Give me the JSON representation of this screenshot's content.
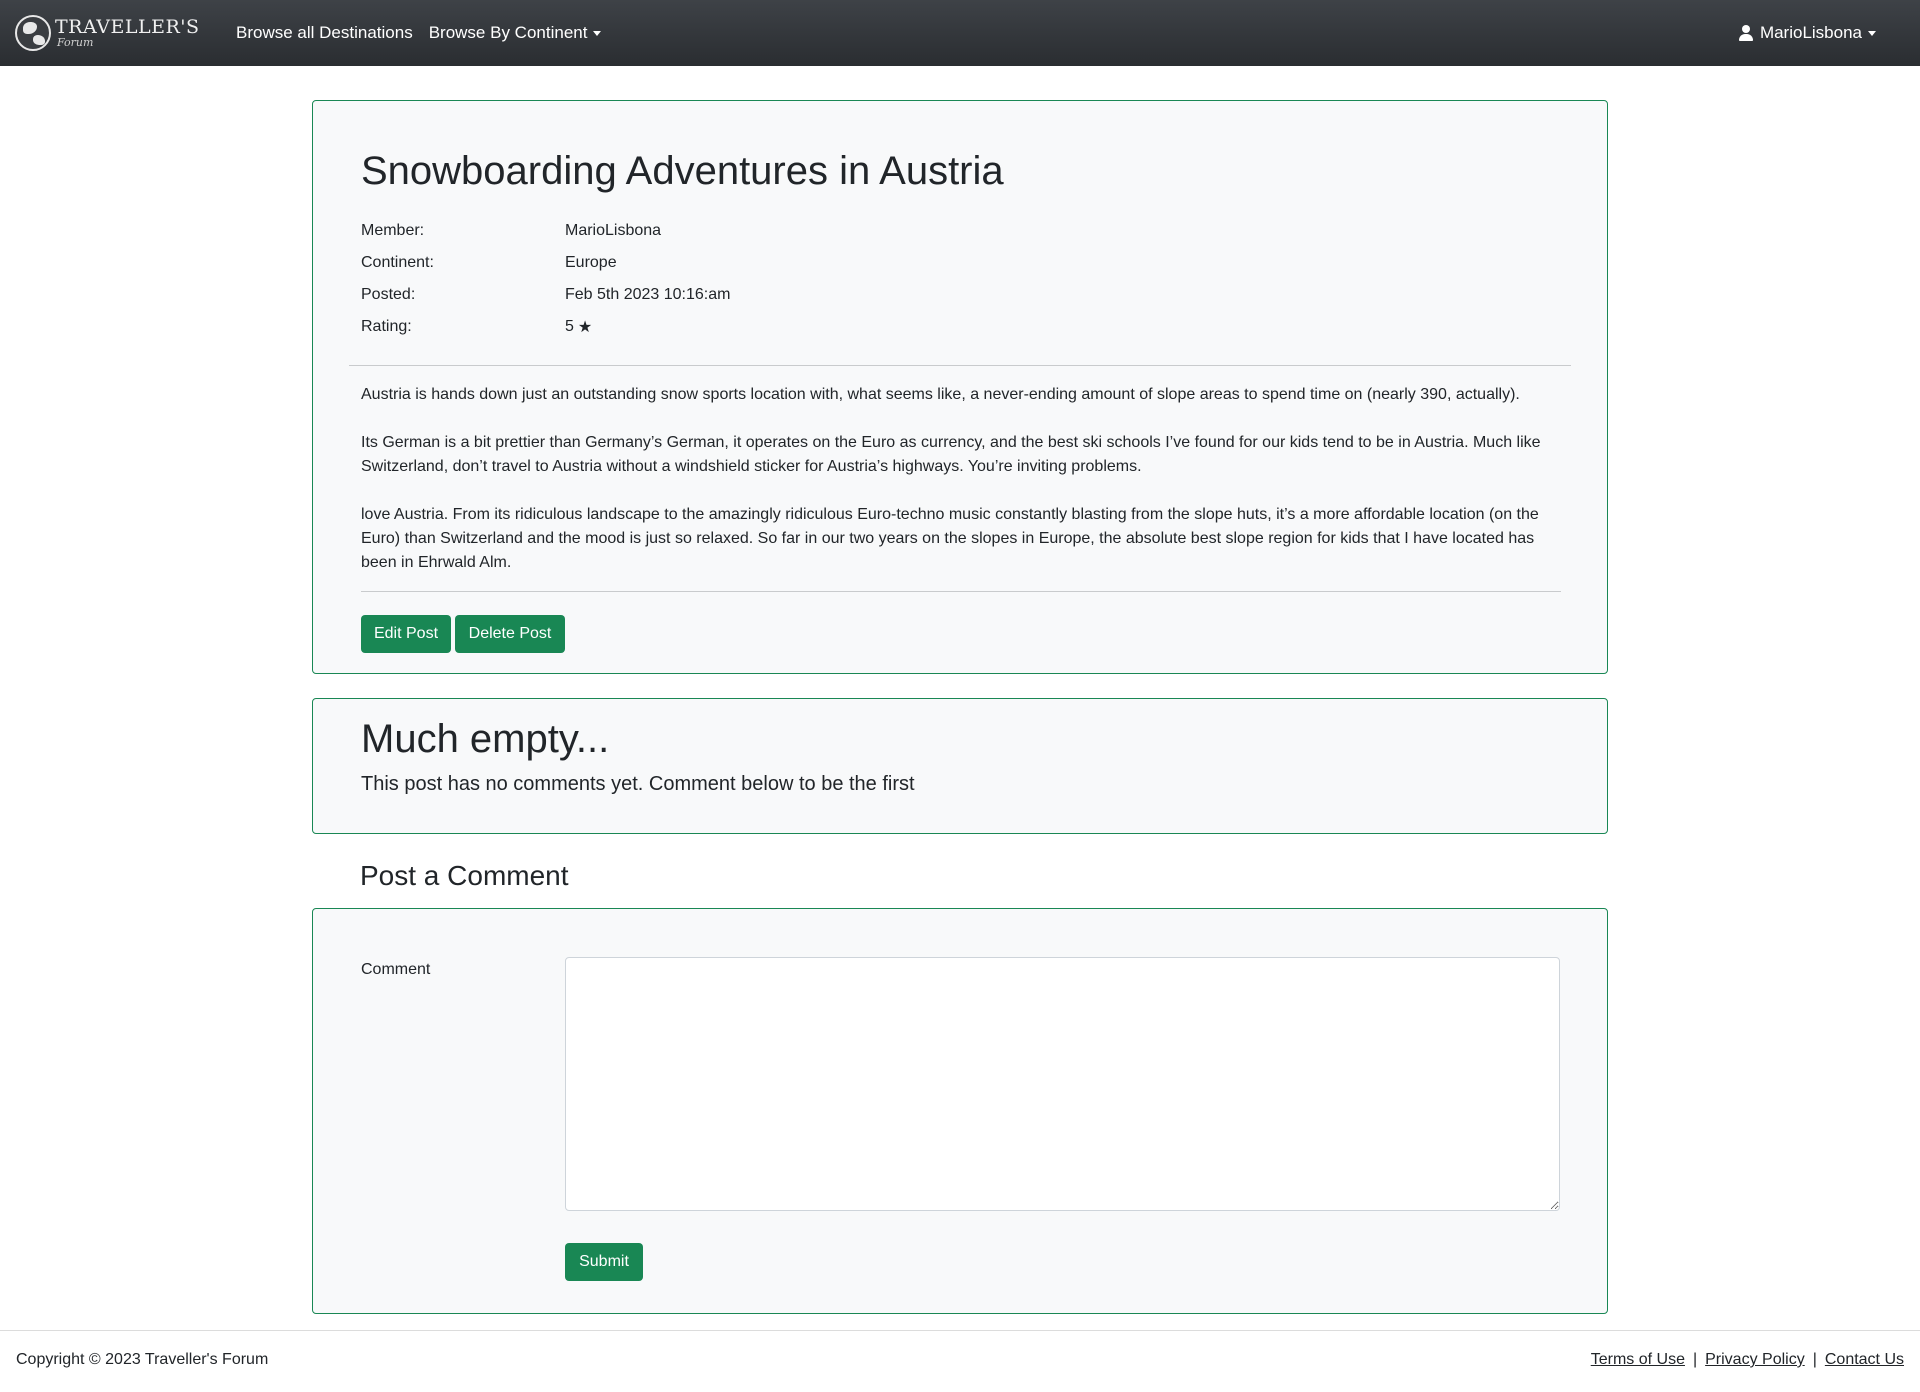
{
  "navbar": {
    "brand_name": "TRAVELLER'S",
    "brand_sub": "Forum",
    "links": [
      "Browse all Destinations",
      "Browse By Continent"
    ],
    "user": "MarioLisbona"
  },
  "post": {
    "title": "Snowboarding Adventures in Austria",
    "meta": [
      {
        "label": "Member:",
        "value": "MarioLisbona"
      },
      {
        "label": "Continent:",
        "value": "Europe"
      },
      {
        "label": "Posted:",
        "value": "Feb 5th 2023 10:16:am"
      },
      {
        "label": "Rating:",
        "value": "5"
      }
    ],
    "rating_icon": "star-icon",
    "paragraphs": [
      "Austria is hands down just an outstanding snow sports location with, what seems like, a never-ending amount of slope areas to spend time on (nearly 390, actually).",
      "Its German is a bit prettier than Germany’s German, it operates on the Euro as currency, and the best ski schools I’ve found for our kids tend to be in Austria. Much like Switzerland, don’t travel to Austria without a windshield sticker for Austria’s highways. You’re inviting problems.",
      " love Austria. From its ridiculous landscape to the amazingly ridiculous Euro-techno music constantly blasting from the slope huts, it’s a more affordable location (on the Euro) than Switzerland and the mood is just so relaxed. So far in our two years on the slopes in Europe, the absolute best slope region for kids that I have located has been in Ehrwald Alm."
    ],
    "edit_label": "Edit Post",
    "delete_label": "Delete Post"
  },
  "comments_empty": {
    "title": "Much empty...",
    "text": "This post has no comments yet. Comment below to be the first"
  },
  "comment_form": {
    "heading": "Post a Comment",
    "label": "Comment",
    "value": "",
    "submit_label": "Submit"
  },
  "footer": {
    "copyright": "Copyright © 2023 Traveller's Forum",
    "links": [
      "Terms of Use",
      "Privacy Policy",
      "Contact Us"
    ],
    "separator": "|"
  },
  "colors": {
    "accent": "#198754",
    "navbar": "#2f3237",
    "card_bg": "#f8f9fa"
  }
}
